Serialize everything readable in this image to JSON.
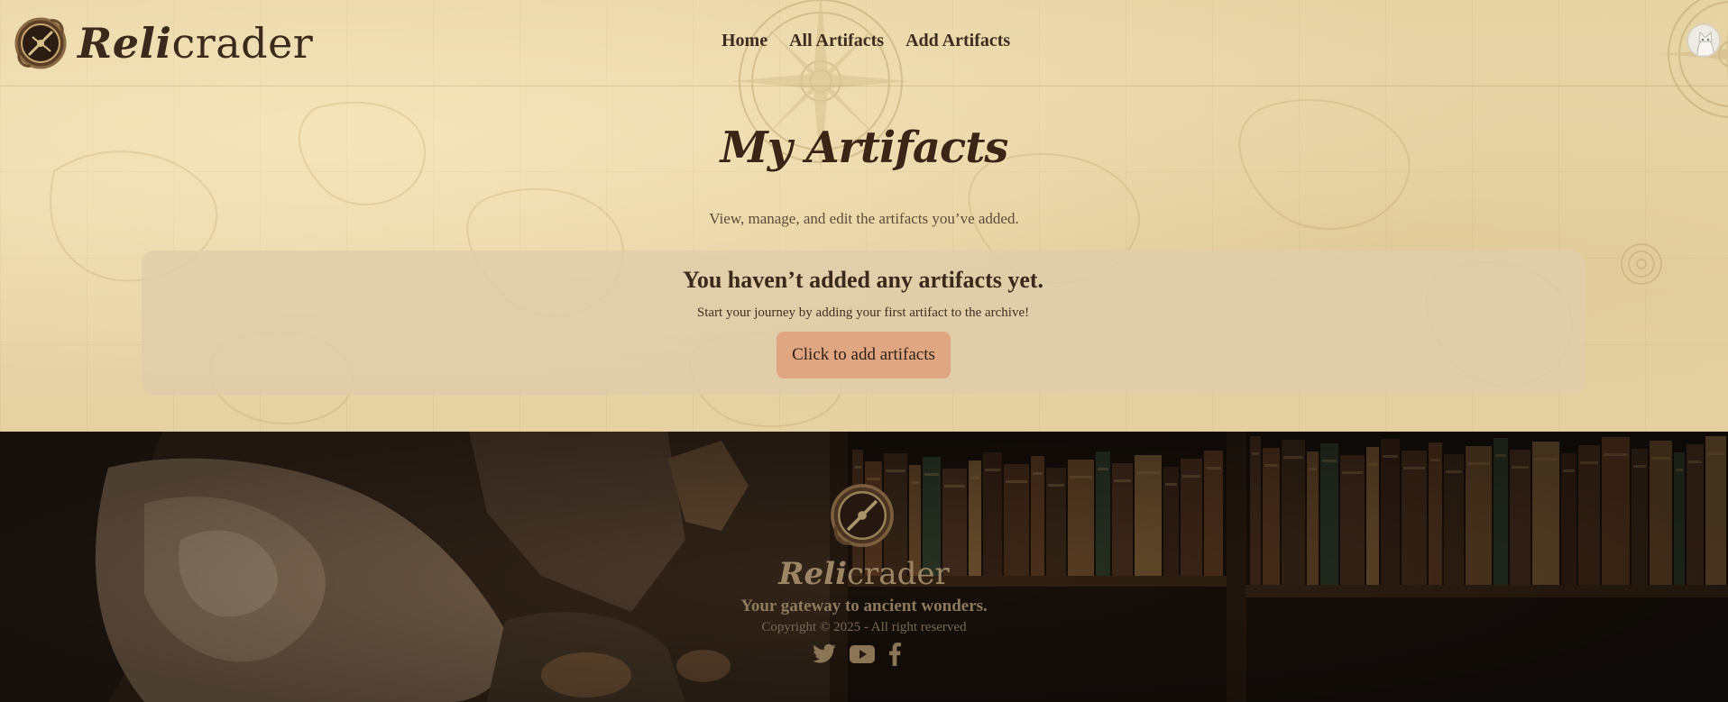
{
  "header": {
    "brand_part1": "Reli",
    "brand_part2": "crader",
    "nav": [
      {
        "label": "Home"
      },
      {
        "label": "All Artifacts"
      },
      {
        "label": "Add Artifacts"
      }
    ]
  },
  "main": {
    "title": "My Artifacts",
    "subtitle": "View, manage, and edit the artifacts you’ve added.",
    "empty_state": {
      "title": "You haven’t added any artifacts yet.",
      "text": "Start your journey by adding your first artifact to the archive!",
      "cta_label": "Click to add artifacts"
    }
  },
  "footer": {
    "brand_part1": "Reli",
    "brand_part2": "crader",
    "tagline": "Your gateway to ancient wonders.",
    "copyright": "Copyright © 2025 - All right reserved",
    "socials": [
      "twitter-icon",
      "youtube-icon",
      "facebook-icon"
    ]
  },
  "colors": {
    "parchment": "#e6d3a4",
    "card": "#ddcfa9",
    "cta": "#e0a682",
    "text_dark": "#3a2a1c",
    "footer_text": "#9c8565"
  }
}
